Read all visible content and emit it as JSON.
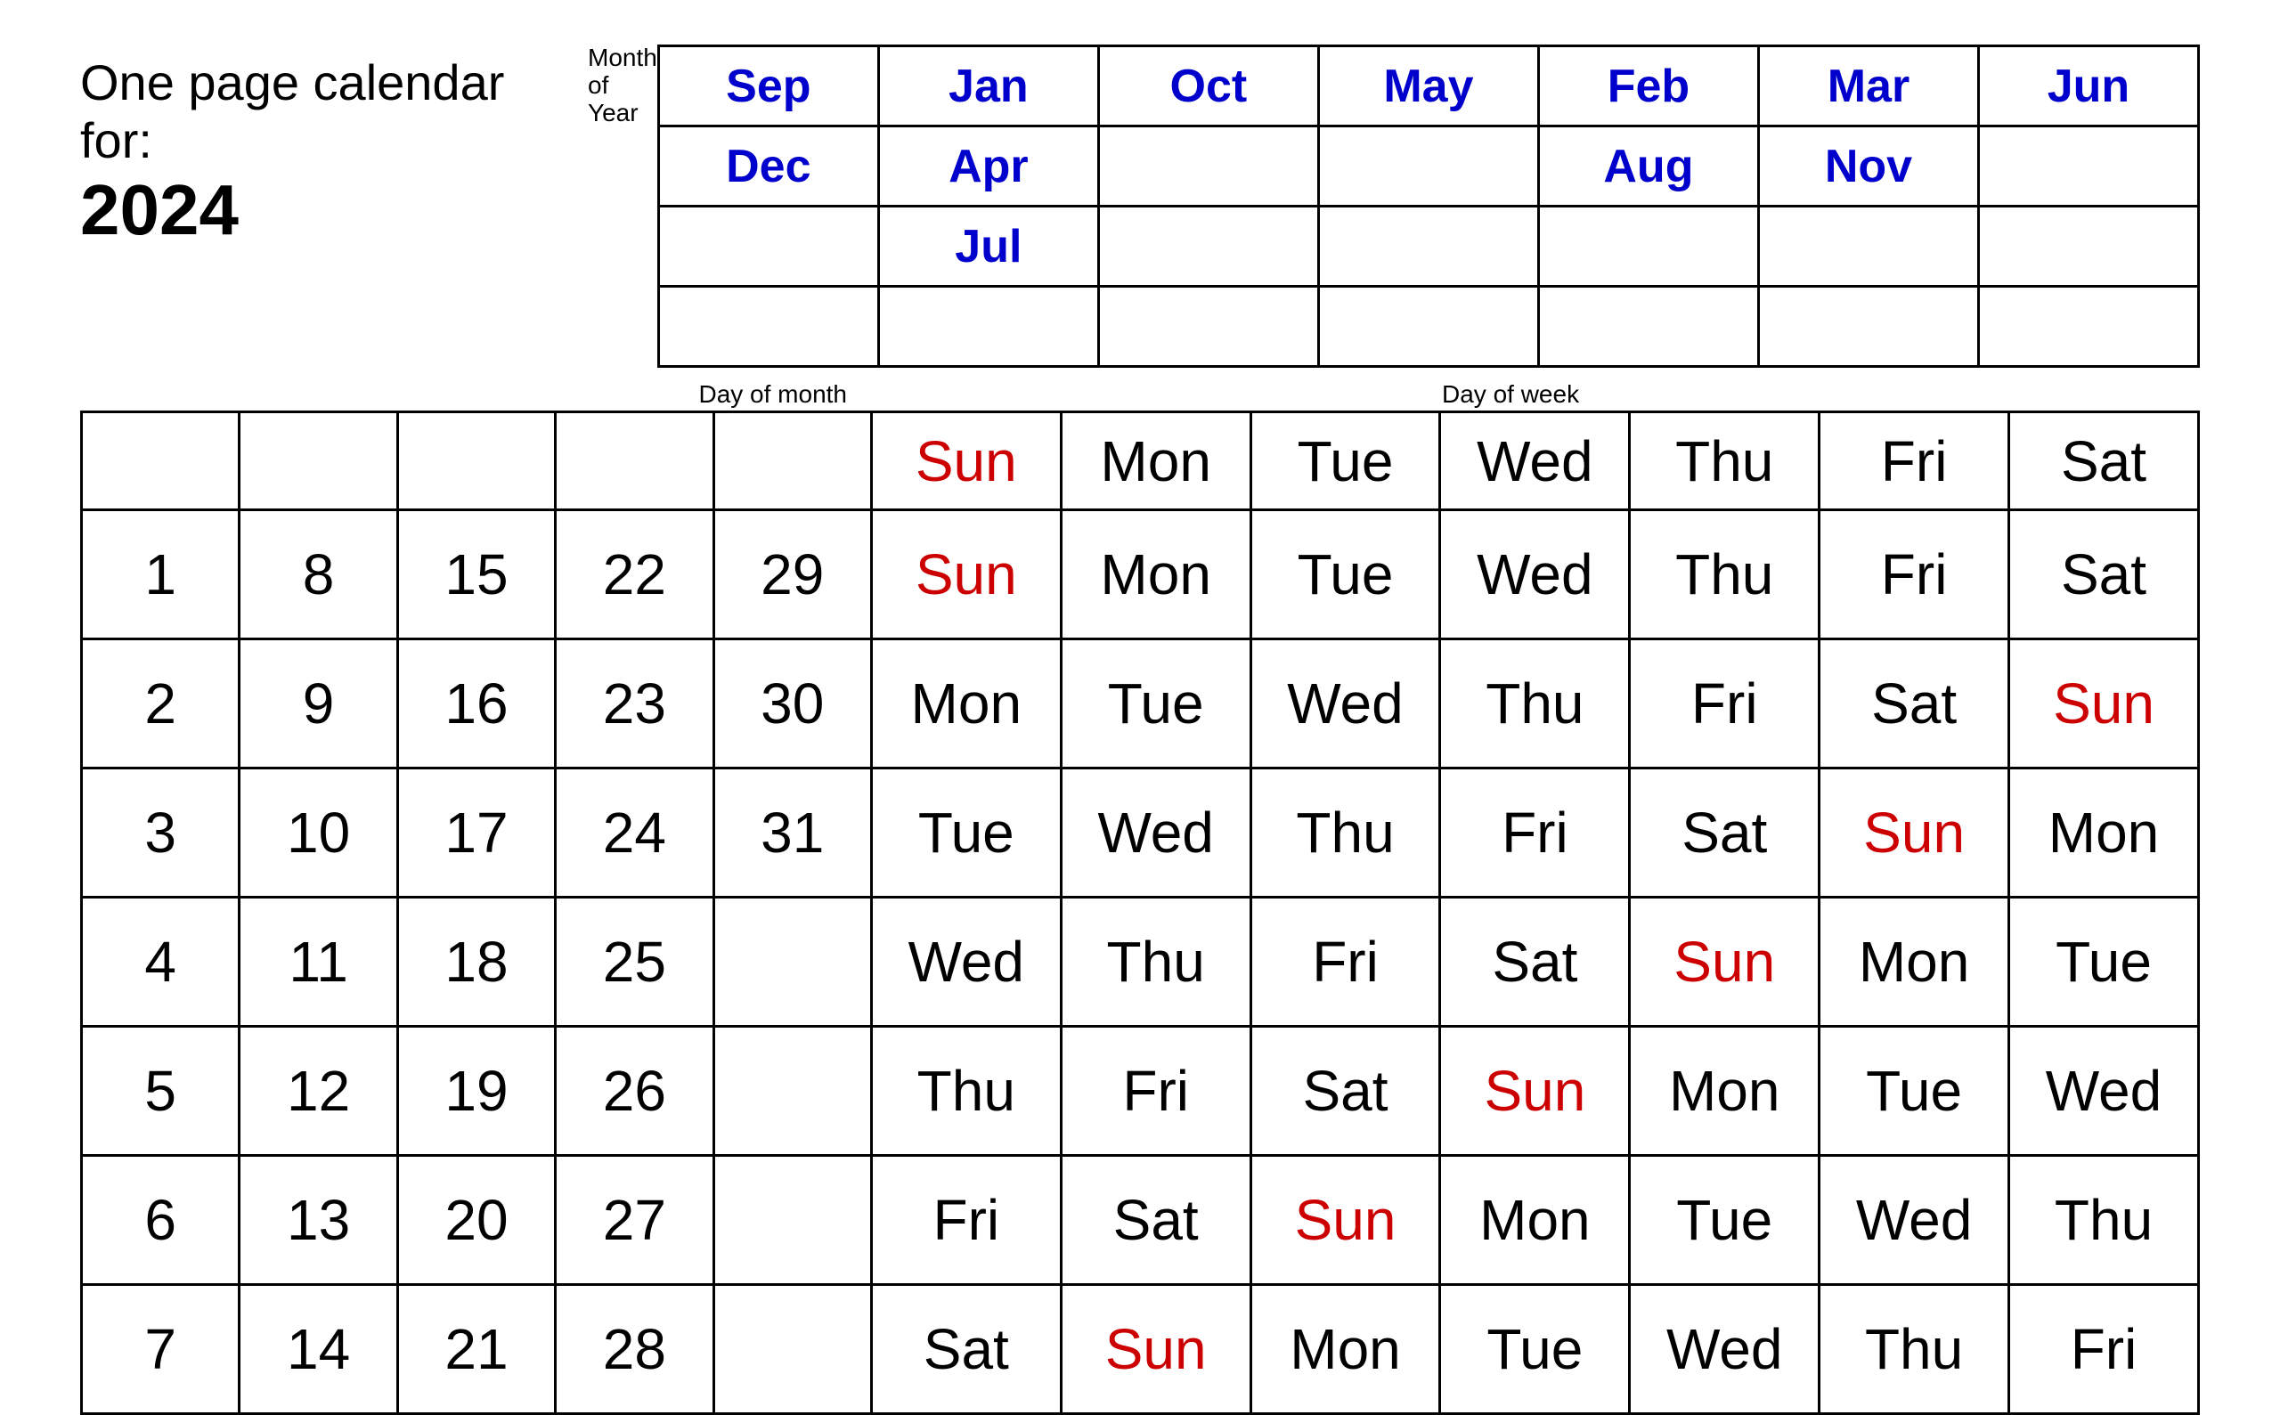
{
  "title": {
    "line1": "One page calendar for:",
    "year": "2024",
    "month_of_year_label": [
      "Month",
      "of",
      "Year"
    ],
    "day_of_month_label": "Day of month",
    "day_of_week_label": "Day of week"
  },
  "month_header": {
    "rows": [
      [
        "Sep",
        "Jan",
        "Oct",
        "May",
        "Feb",
        "Mar",
        "Jun"
      ],
      [
        "Dec",
        "Apr",
        "",
        "",
        "Aug",
        "Nov",
        ""
      ],
      [
        "",
        "Jul",
        "",
        "",
        "",
        "",
        ""
      ],
      [
        "",
        "",
        "",
        "",
        "",
        "",
        ""
      ]
    ]
  },
  "header_row": [
    "Sun",
    "Mon",
    "Tue",
    "Wed",
    "Thu",
    "Fri",
    "Sat"
  ],
  "day_numbers": [
    [
      "1",
      "8",
      "15",
      "22",
      "29"
    ],
    [
      "2",
      "9",
      "16",
      "23",
      "30"
    ],
    [
      "3",
      "10",
      "17",
      "24",
      "31"
    ],
    [
      "4",
      "11",
      "18",
      "25",
      ""
    ],
    [
      "5",
      "12",
      "19",
      "26",
      ""
    ],
    [
      "6",
      "13",
      "20",
      "27",
      ""
    ],
    [
      "7",
      "14",
      "21",
      "28",
      ""
    ]
  ],
  "day_of_week_rows": [
    [
      "Sun",
      "Mon",
      "Tue",
      "Wed",
      "Thu",
      "Fri",
      "Sat"
    ],
    [
      "Mon",
      "Tue",
      "Wed",
      "Thu",
      "Fri",
      "Sat",
      "Sun"
    ],
    [
      "Tue",
      "Wed",
      "Thu",
      "Fri",
      "Sat",
      "Sun",
      "Mon"
    ],
    [
      "Wed",
      "Thu",
      "Fri",
      "Sat",
      "Sun",
      "Mon",
      "Tue"
    ],
    [
      "Thu",
      "Fri",
      "Sat",
      "Sun",
      "Mon",
      "Tue",
      "Wed"
    ],
    [
      "Fri",
      "Sat",
      "Sun",
      "Mon",
      "Tue",
      "Wed",
      "Thu"
    ],
    [
      "Sat",
      "Sun",
      "Mon",
      "Tue",
      "Wed",
      "Thu",
      "Fri"
    ]
  ]
}
